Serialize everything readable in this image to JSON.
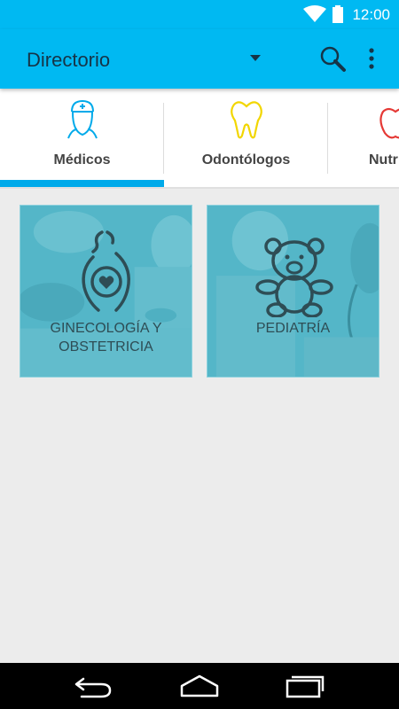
{
  "status_bar": {
    "time": "12:00"
  },
  "app_bar": {
    "title": "Directorio"
  },
  "tabs": [
    {
      "label": "Médicos",
      "icon": "doctor-icon",
      "selected": true
    },
    {
      "label": "Odontólogos",
      "icon": "tooth-icon",
      "selected": false
    },
    {
      "label": "Nutr",
      "icon": "apple-icon",
      "selected": false
    }
  ],
  "cards": [
    {
      "label_line1": "GINECOLOGÍA Y",
      "label_line2": "OBSTETRICIA",
      "icon": "pregnant-woman-icon"
    },
    {
      "label": "PEDIATRÍA",
      "icon": "teddy-bear-icon"
    }
  ],
  "colors": {
    "primary": "#00b9f2",
    "indicator": "#00aaea",
    "tooth": "#f2d600",
    "doctor": "#00aaea",
    "apple": "#e53935",
    "card_tint": "#54b6c8"
  }
}
